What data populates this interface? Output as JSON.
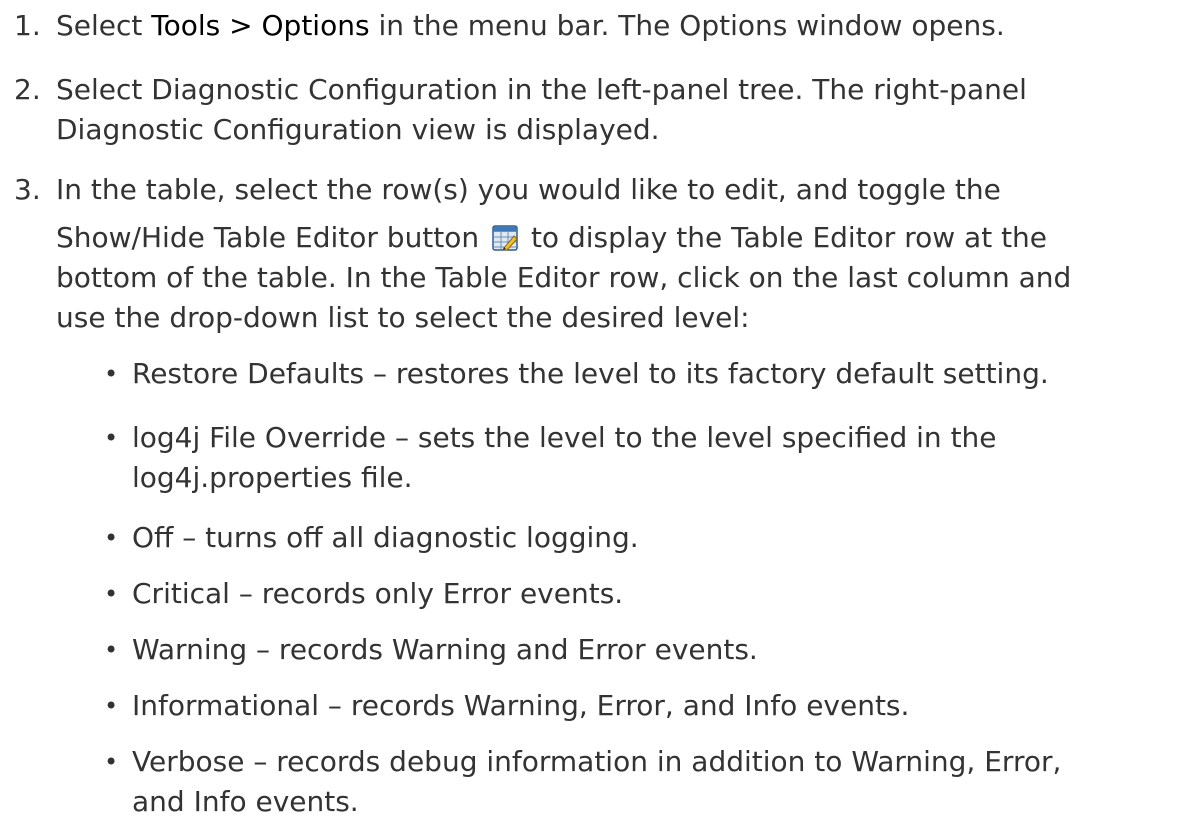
{
  "steps": [
    {
      "num": "1.",
      "before": "Select ",
      "emph": "Tools > Options",
      "after": " in the menu bar. The Options window opens."
    },
    {
      "num": "2.",
      "line1": "Select Diagnostic Configuration in the left-panel tree. The right-panel",
      "line2": "Diagnostic Configuration view is displayed."
    },
    {
      "num": "3.",
      "line1": "In the table, select the row(s) you would like to edit, and toggle the",
      "line2_before": "Show/Hide Table Editor button ",
      "line2_after": " to display the Table Editor row at the",
      "line3": "bottom of the table. In the Table Editor row, click on the last column and",
      "line4": "use the drop-down list to select the desired level:",
      "icon": "table-editor-icon"
    }
  ],
  "levels": [
    {
      "lines": [
        "Restore Defaults – restores the level to its factory default setting."
      ]
    },
    {
      "lines": [
        "log4j File Override – sets the level to the level specified in the",
        "log4j.properties file."
      ]
    },
    {
      "lines": [
        "Off – turns off all diagnostic logging."
      ]
    },
    {
      "lines": [
        "Critical – records only Error events."
      ]
    },
    {
      "lines": [
        "Warning – records Warning and Error events."
      ]
    },
    {
      "lines": [
        "Informational – records Warning, Error, and Info events."
      ]
    },
    {
      "lines": [
        "Verbose – records debug information in addition to Warning, Error,",
        "and Info events."
      ]
    }
  ],
  "bullet_char": "•",
  "colors": {
    "text": "#333333",
    "emphasis": "#000000",
    "background": "#ffffff"
  }
}
